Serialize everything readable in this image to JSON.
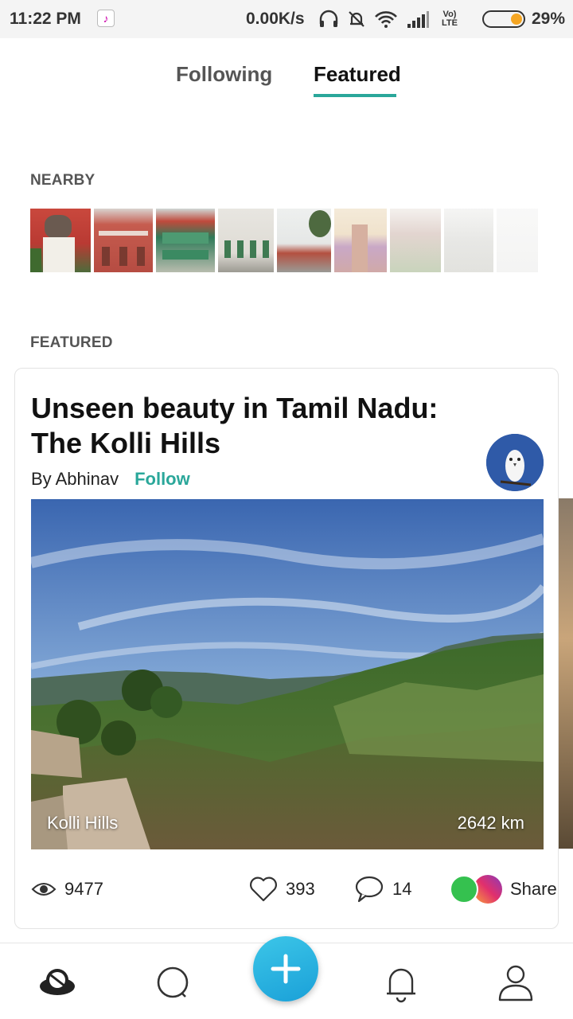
{
  "status_bar": {
    "time": "11:22 PM",
    "speed": "0.00K/s",
    "lte": "Vo) LTE",
    "battery_pct": "29%",
    "battery_level": 0.29,
    "icons": [
      "headphones-icon",
      "bell-off-icon",
      "wifi-icon",
      "signal-icon"
    ]
  },
  "tabs": {
    "following": "Following",
    "featured": "Featured",
    "active": "featured"
  },
  "nearby": {
    "label": "NEARBY",
    "thumb_count": 9
  },
  "featured": {
    "label": "FEATURED",
    "card": {
      "title": "Unseen beauty in Tamil Nadu: The Kolli Hills",
      "author": "By Abhinav",
      "follow": "Follow",
      "caption": "Kolli Hills",
      "distance": "2642 km",
      "views": "9477",
      "likes": "393",
      "comments": "14",
      "share": "Share"
    }
  },
  "colors": {
    "accent": "#2aa79a",
    "fab": "#1aa0d8"
  },
  "nav": [
    "explore-icon",
    "search-icon",
    "add-icon",
    "notifications-icon",
    "profile-icon"
  ]
}
